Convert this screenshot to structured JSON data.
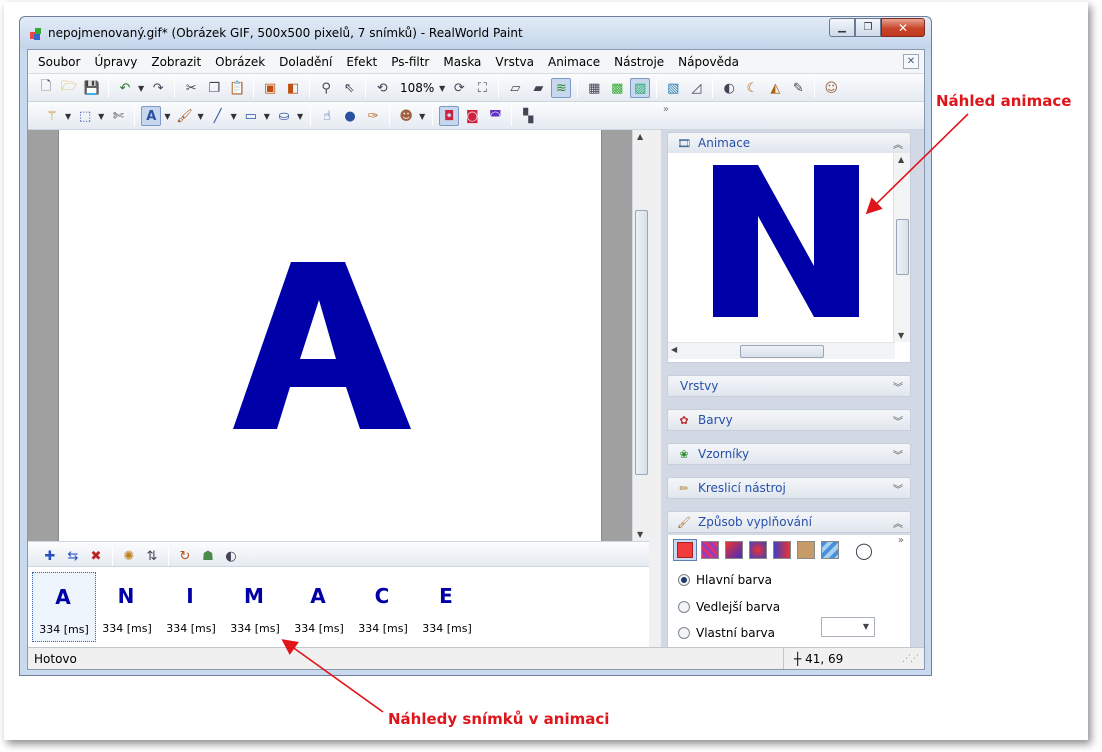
{
  "window": {
    "title": "nepojmenovaný.gif* (Obrázek GIF, 500x500 pixelů, 7 snímků) - RealWorld Paint"
  },
  "menu": [
    "Soubor",
    "Úpravy",
    "Zobrazit",
    "Obrázek",
    "Doladění",
    "Efekt",
    "Ps-filtr",
    "Maska",
    "Vrstva",
    "Animace",
    "Nástroje",
    "Nápověda"
  ],
  "toolbar": {
    "zoom": "108%"
  },
  "canvas": {
    "letter": "A",
    "letter_color": "#0000a8"
  },
  "frames": [
    {
      "letter": "A",
      "time": "334 [ms]"
    },
    {
      "letter": "N",
      "time": "334 [ms]"
    },
    {
      "letter": "I",
      "time": "334 [ms]"
    },
    {
      "letter": "M",
      "time": "334 [ms]"
    },
    {
      "letter": "A",
      "time": "334 [ms]"
    },
    {
      "letter": "C",
      "time": "334 [ms]"
    },
    {
      "letter": "E",
      "time": "334 [ms]"
    }
  ],
  "panels": {
    "animace": {
      "title": "Animace",
      "preview_letter": "N"
    },
    "vrstvy": "Vrstvy",
    "barvy": "Barvy",
    "vzorniky": "Vzorníky",
    "kreslici": "Kreslicí nástroj",
    "zpusob": "Způsob vyplňování"
  },
  "fill": {
    "options": [
      "Hlavní barva",
      "Vedlejší barva",
      "Vlastní barva"
    ],
    "selected": "Hlavní barva"
  },
  "status": {
    "text": "Hotovo",
    "coords": "41, 69"
  },
  "annotations": {
    "preview": "Náhled animace",
    "frames": "Náhledy snímků v animaci"
  },
  "colors": {
    "accent_red": "#e0141b",
    "letter_blue": "#0000a8",
    "panel_title_blue": "#2650a8"
  }
}
